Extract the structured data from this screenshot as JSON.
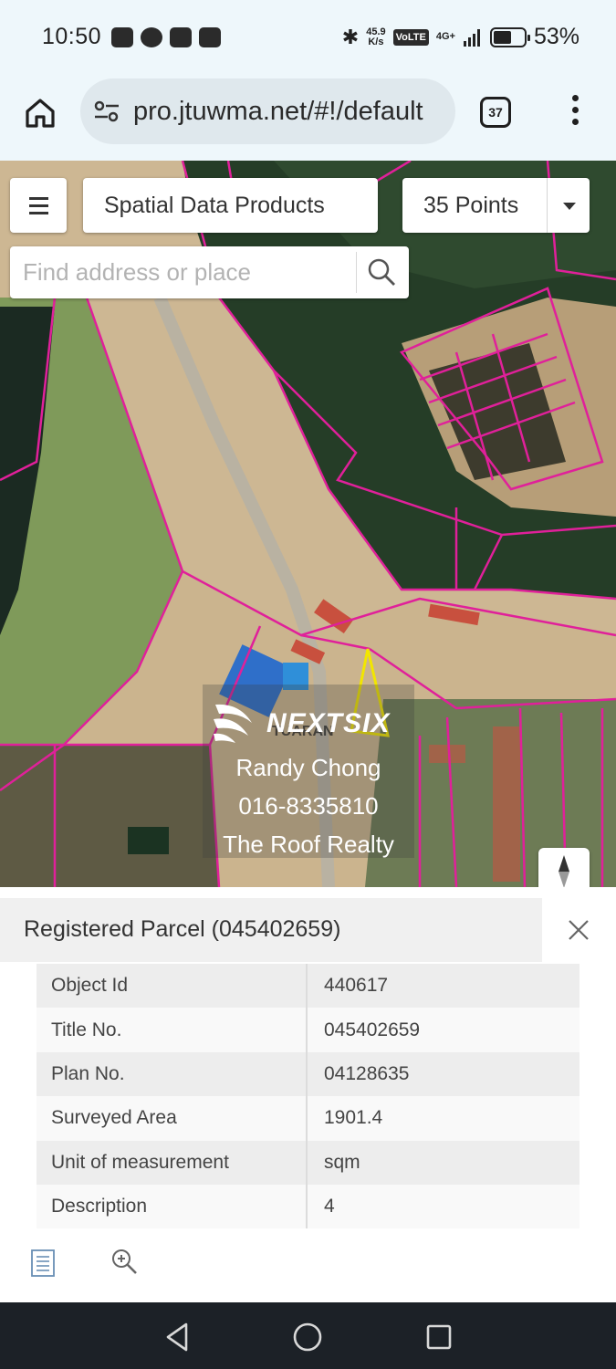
{
  "status_bar": {
    "time": "10:50",
    "net_speed_value": "45.9",
    "net_speed_unit": "K/s",
    "volte": "VoLTE",
    "network": "4G+",
    "battery": "53%",
    "icons": [
      "nfc-icon",
      "alarm-icon",
      "youtube-icon",
      "youtube-icon",
      "bluetooth-icon",
      "signal-icon",
      "battery-icon"
    ]
  },
  "browser": {
    "url": "pro.jtuwma.net/#!/default",
    "tab_count": "37",
    "icons": [
      "home-icon",
      "site-settings-icon",
      "tabs-icon",
      "more-vert-icon"
    ]
  },
  "map": {
    "title": "Spatial Data Products",
    "points_label": "35 Points",
    "search_placeholder": "Find address or place",
    "map_label": "TUARAN",
    "parcel_color": "#e0209a",
    "selected_parcel_color": "#f2e600",
    "icons": [
      "hamburger-menu-icon",
      "dropdown-caret-icon",
      "search-icon",
      "compass-icon"
    ]
  },
  "watermark": {
    "brand": "NEXTSIX",
    "name": "Randy Chong",
    "phone": "016-8335810",
    "company": "The Roof Realty"
  },
  "panel": {
    "title": "Registered Parcel (045402659)",
    "attributes": [
      {
        "label": "Object Id",
        "value": "440617"
      },
      {
        "label": "Title No.",
        "value": "045402659"
      },
      {
        "label": "Plan No.",
        "value": "04128635"
      },
      {
        "label": "Surveyed Area",
        "value": "1901.4"
      },
      {
        "label": "Unit of measurement",
        "value": "sqm"
      },
      {
        "label": "Description",
        "value": "4"
      }
    ],
    "icons": [
      "close-icon",
      "attribute-table-icon",
      "zoom-to-icon"
    ]
  },
  "nav_bar": {
    "icons": [
      "back-icon",
      "home-circle-icon",
      "recents-icon"
    ]
  }
}
